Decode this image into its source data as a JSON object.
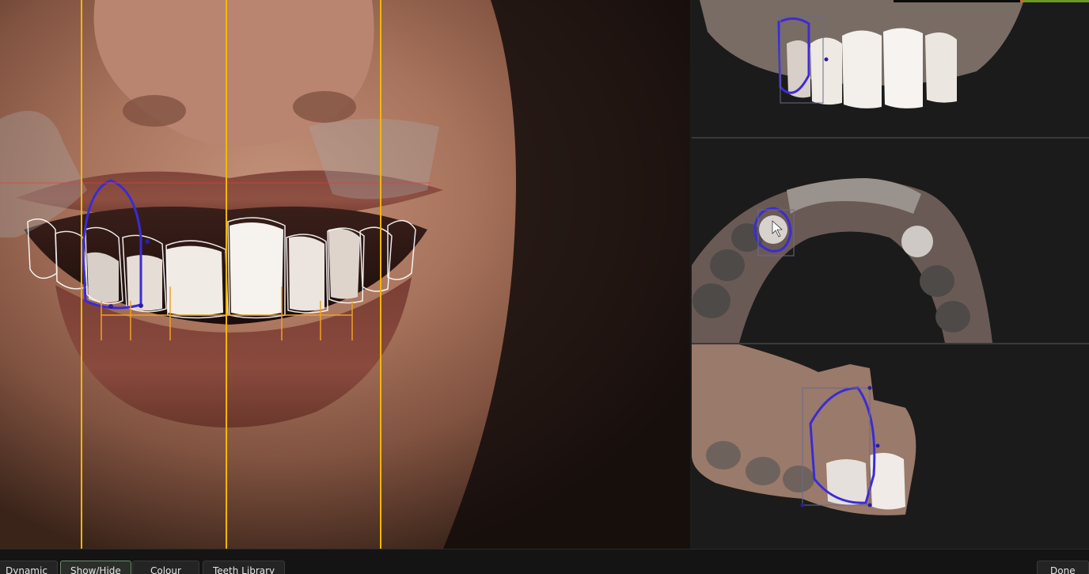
{
  "toolbar": {
    "dynamic_label": "Dynamic",
    "showhide_label": "Show/Hide",
    "colour_label": "Colour",
    "teeth_library_label": "Teeth Library",
    "done_label": "Done"
  },
  "colors": {
    "midline": "#f2b705",
    "outline": "#3b2bd6",
    "tooth_outline": "#ffffff",
    "measure": "#f0a020",
    "smile_line": "#e04040"
  },
  "icons": {
    "cursor": "arrow-cursor-icon"
  }
}
